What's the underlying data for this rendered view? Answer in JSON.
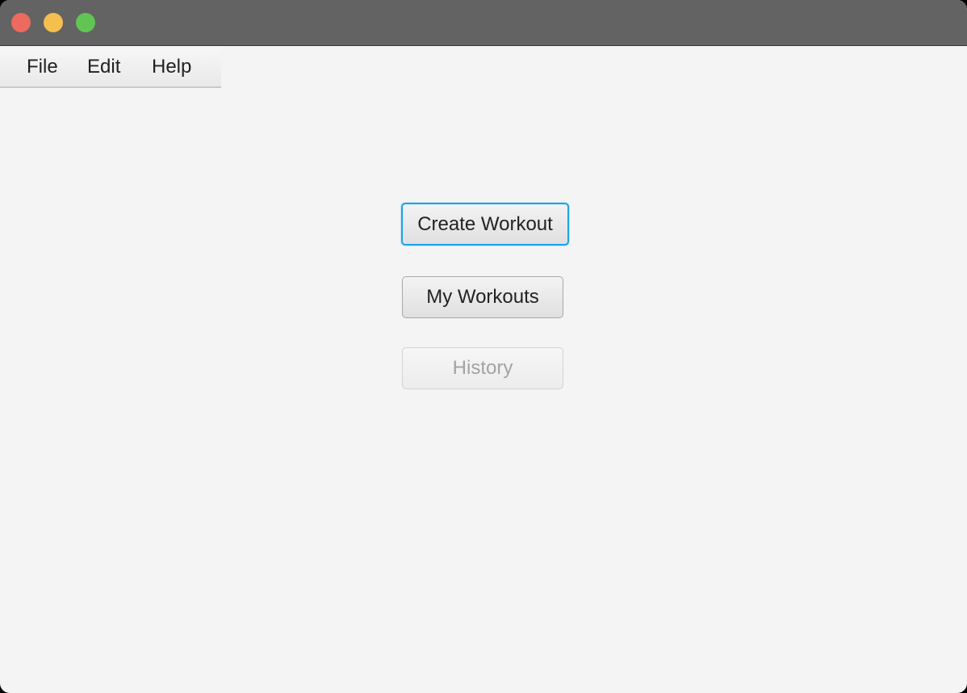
{
  "window": {
    "controls": {
      "close": "close-icon",
      "minimize": "minimize-icon",
      "maximize": "maximize-icon"
    }
  },
  "menubar": {
    "items": [
      {
        "label": "File"
      },
      {
        "label": "Edit"
      },
      {
        "label": "Help"
      }
    ]
  },
  "main": {
    "create_workout_label": "Create Workout",
    "my_workouts_label": "My Workouts",
    "history_label": "History",
    "history_disabled": true
  },
  "colors": {
    "titlebar": "#636363",
    "background": "#f4f4f4",
    "focus_ring": "#1ea3e6",
    "close": "#ed6a5e",
    "minimize": "#f5bf4f",
    "maximize": "#61c554"
  }
}
